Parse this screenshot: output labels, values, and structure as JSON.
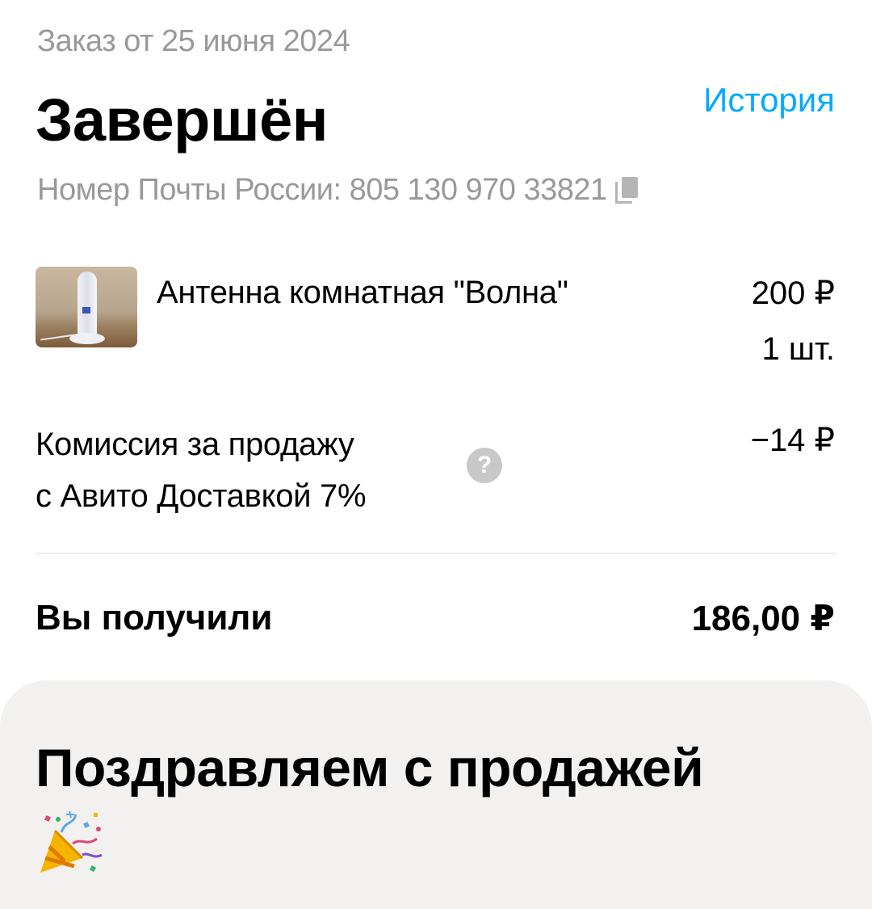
{
  "order": {
    "date_line": "Заказ от 25 июня 2024",
    "status": "Завершён",
    "history_link": "История",
    "tracking_line": "Номер Почты России: 805 130 970 33821"
  },
  "product": {
    "name": "Антенна комнатная \"Волна\"",
    "price": "200 ₽",
    "quantity": "1 шт."
  },
  "commission": {
    "label_line1": "Комиссия за продажу",
    "label_line2": "с Авито Доставкой 7%",
    "amount": "−14 ₽",
    "help_glyph": "?"
  },
  "total": {
    "label": "Вы получили",
    "amount": "186,00 ₽"
  },
  "congrats": {
    "title": "Поздравляем с продажей",
    "icon": "party-popper-icon"
  },
  "colors": {
    "accent_link": "#00aaff",
    "muted_text": "#999999",
    "card_background": "#f2f1f0"
  }
}
